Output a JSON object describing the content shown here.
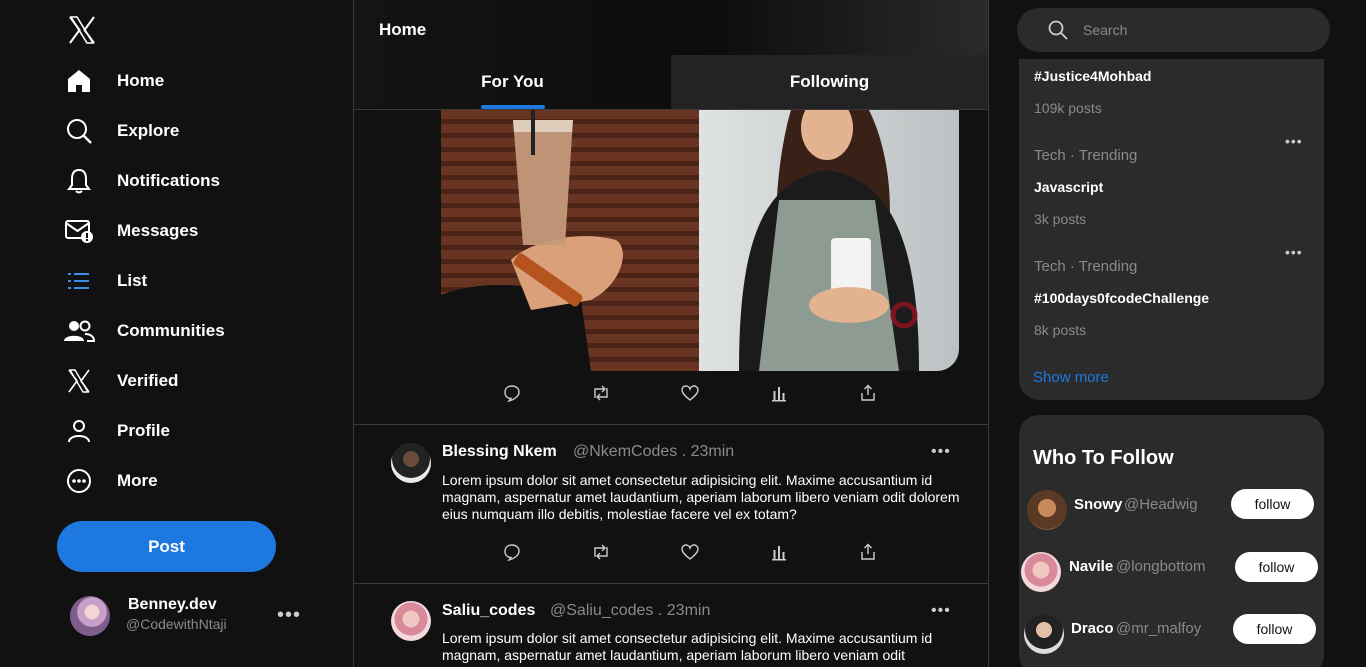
{
  "sidebar": {
    "logo": "x-logo",
    "items": [
      {
        "label": "Home",
        "icon": "home-icon"
      },
      {
        "label": "Explore",
        "icon": "search-icon"
      },
      {
        "label": "Notifications",
        "icon": "bell-icon"
      },
      {
        "label": "Messages",
        "icon": "mail-icon"
      },
      {
        "label": "List",
        "icon": "list-icon"
      },
      {
        "label": "Communities",
        "icon": "people-icon"
      },
      {
        "label": "Verified",
        "icon": "x-icon"
      },
      {
        "label": "Profile",
        "icon": "user-icon"
      },
      {
        "label": "More",
        "icon": "more-circle-icon"
      }
    ],
    "post_label": "Post",
    "account": {
      "name": "Benney.dev",
      "handle": "@CodewithNtaji",
      "more": "•••"
    }
  },
  "feed": {
    "title": "Home",
    "tabs": [
      {
        "label": "For You",
        "active": true
      },
      {
        "label": "Following",
        "active": false
      }
    ],
    "tweets": [
      {
        "name": "Blessing Nkem",
        "handle": "@NkemCodes",
        "time": ". 23min",
        "more": "•••",
        "text": "Lorem ipsum dolor sit amet consectetur adipisicing elit. Maxime accusantium id magnam, aspernatur amet laudantium, aperiam laborum libero veniam odit dolorem eius numquam illo debitis, molestiae facere vel ex totam?"
      },
      {
        "name": "Saliu_codes",
        "handle": "@Saliu_codes",
        "time": ". 23min",
        "more": "•••",
        "text": "Lorem ipsum dolor sit amet consectetur adipisicing elit. Maxime accusantium id magnam, aspernatur amet laudantium, aperiam laborum libero veniam odit"
      }
    ],
    "action_icons": [
      "reply-icon",
      "retweet-icon",
      "like-icon",
      "analytics-icon",
      "share-icon"
    ]
  },
  "search": {
    "placeholder": "Search"
  },
  "trends": [
    {
      "category": "",
      "topic": "#Justice4Mohbad",
      "count": "109k posts"
    },
    {
      "category": "Tech · Trending",
      "topic": "Javascript",
      "count": "3k posts"
    },
    {
      "category": "Tech · Trending",
      "topic": "#100days0fcodeChallenge",
      "count": "8k posts"
    }
  ],
  "trend_more": "•••",
  "show_more": "Show more",
  "who_to_follow": {
    "title": "Who To Follow",
    "users": [
      {
        "name": "Snowy",
        "handle": "@Headwig",
        "button": "follow"
      },
      {
        "name": "Navile",
        "handle": "@longbottom",
        "button": "follow"
      },
      {
        "name": "Draco",
        "handle": "@mr_malfoy",
        "button": "follow"
      }
    ]
  },
  "colors": {
    "accent": "#1d78e0",
    "background": "#111111",
    "card": "#2b2b2b",
    "muted": "#8a8a8a"
  }
}
